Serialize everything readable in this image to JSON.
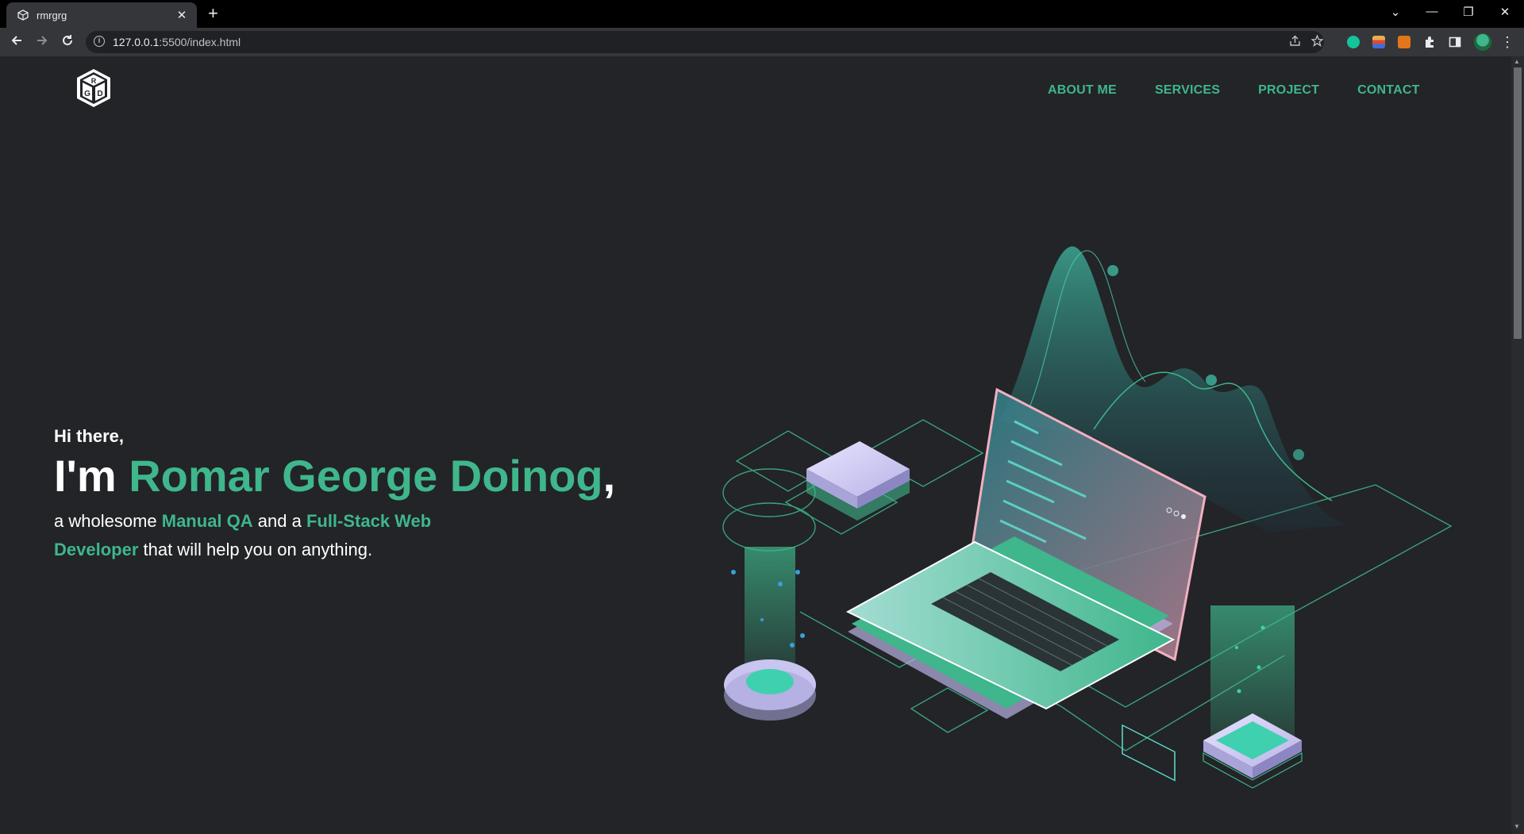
{
  "browser": {
    "tab_title": "rmrgrg",
    "tab_close": "✕",
    "new_tab": "+",
    "url_host": "127.0.0.1",
    "url_rest": ":5500/index.html",
    "window_controls": [
      "⌄",
      "—",
      "❐",
      "✕"
    ]
  },
  "nav": {
    "items": [
      "ABOUT ME",
      "SERVICES",
      "PROJECT",
      "CONTACT"
    ]
  },
  "hero": {
    "greeting": "Hi there,",
    "im": "I'm ",
    "name": "Romar George Doinog",
    "comma": ",",
    "tagline": {
      "p1": "a wholesome ",
      "role1": "Manual QA",
      "p2": " and a ",
      "role2": "Full-Stack Web Developer",
      "p3": " that will help you on anything."
    }
  },
  "colors": {
    "accent": "#3fb68b",
    "background": "#222427",
    "text": "#ffffff"
  },
  "icons": {
    "logo": "cube-logo-icon",
    "hero": "isometric-laptop-illustration"
  }
}
